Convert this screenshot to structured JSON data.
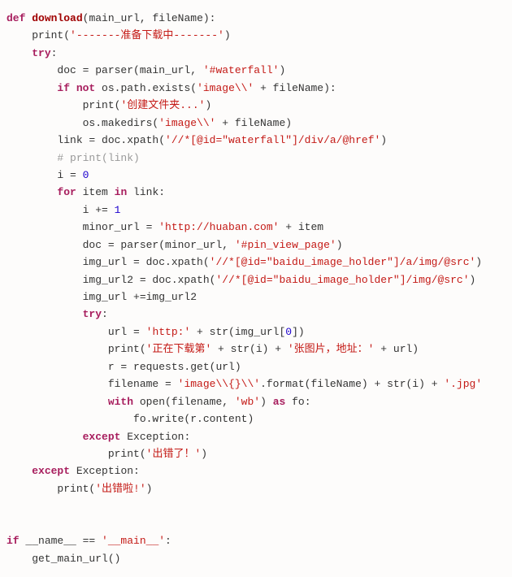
{
  "code": {
    "l01": {
      "a": "def",
      "b": " ",
      "c": "download",
      "d": "(main_url, fileName):"
    },
    "l02": {
      "a": "    print(",
      "b": "'-------准备下载中-------'",
      "c": ")"
    },
    "l03": {
      "a": "    ",
      "b": "try",
      "c": ":"
    },
    "l04": {
      "a": "        doc = parser(main_url, ",
      "b": "'#waterfall'",
      "c": ")"
    },
    "l05": {
      "a": "        ",
      "b": "if not",
      "c": " os.path.exists(",
      "d": "'image\\\\'",
      "e": " + fileName):"
    },
    "l06": {
      "a": "            print(",
      "b": "'创建文件夹...'",
      "c": ")"
    },
    "l07": {
      "a": "            os.makedirs(",
      "b": "'image\\\\'",
      "c": " + fileName)"
    },
    "l08": {
      "a": "        link = doc.xpath(",
      "b": "'//*[@id=\"waterfall\"]/div/a/@href'",
      "c": ")"
    },
    "l09": {
      "a": "        ",
      "b": "# print(link)"
    },
    "l10": {
      "a": "        i = ",
      "b": "0"
    },
    "l11": {
      "a": "        ",
      "b": "for",
      "c": " item ",
      "d": "in",
      "e": " link:"
    },
    "l12": {
      "a": "            i += ",
      "b": "1"
    },
    "l13": {
      "a": "            minor_url = ",
      "b": "'http://huaban.com'",
      "c": " + item"
    },
    "l14": {
      "a": "            doc = parser(minor_url, ",
      "b": "'#pin_view_page'",
      "c": ")"
    },
    "l15": {
      "a": "            img_url = doc.xpath(",
      "b": "'//*[@id=\"baidu_image_holder\"]/a/img/@src'",
      "c": ")"
    },
    "l16": {
      "a": "            img_url2 = doc.xpath(",
      "b": "'//*[@id=\"baidu_image_holder\"]/img/@src'",
      "c": ")"
    },
    "l17": {
      "a": "            img_url +=img_url2"
    },
    "l18": {
      "a": "            ",
      "b": "try",
      "c": ":"
    },
    "l19": {
      "a": "                url = ",
      "b": "'http:'",
      "c": " + str(img_url[",
      "d": "0",
      "e": "])"
    },
    "l20": {
      "a": "                print(",
      "b": "'正在下载第'",
      "c": " + str(i) + ",
      "d": "'张图片，地址：'",
      "e": " + url)"
    },
    "l21": {
      "a": "                r = requests.get(url)"
    },
    "l22": {
      "a": "                filename = ",
      "b": "'image\\\\{}\\\\'",
      "c": ".format(fileName) + str(i) + ",
      "d": "'.jpg'"
    },
    "l23": {
      "a": "                ",
      "b": "with",
      "c": " open(filename, ",
      "d": "'wb'",
      "e": ") ",
      "f": "as",
      "g": " fo:"
    },
    "l24": {
      "a": "                    fo.write(r.content)"
    },
    "l25": {
      "a": "            ",
      "b": "except",
      "c": " Exception:"
    },
    "l26": {
      "a": "                print(",
      "b": "'出错了！'",
      "c": ")"
    },
    "l27": {
      "a": "    ",
      "b": "except",
      "c": " Exception:"
    },
    "l28": {
      "a": "        print(",
      "b": "'出错啦!'",
      "c": ")"
    },
    "blank1": " ",
    "blank2": " ",
    "l29": {
      "a": "if",
      "b": " __name__ == ",
      "c": "'__main__'",
      "d": ":"
    },
    "l30": {
      "a": "    get_main_url()"
    }
  }
}
